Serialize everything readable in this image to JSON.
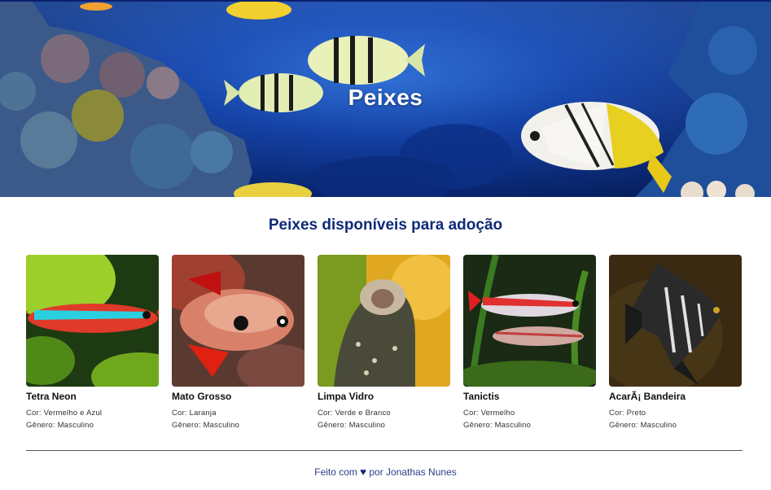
{
  "hero": {
    "title": "Peixes"
  },
  "section": {
    "title": "Peixes disponíveis para adoção"
  },
  "fish": [
    {
      "name": "Tetra Neon",
      "color": "Cor: Vermelho e Azul",
      "gender": "Gênero: Masculino"
    },
    {
      "name": "Mato Grosso",
      "color": "Cor: Laranja",
      "gender": "Gênero: Masculino"
    },
    {
      "name": "Limpa Vidro",
      "color": "Cor: Verde e Branco",
      "gender": "Gênero: Masculino"
    },
    {
      "name": "Tanictis",
      "color": "Cor: Vermelho",
      "gender": "Gênero: Masculino"
    },
    {
      "name": "AcarÃ¡ Bandeira",
      "color": "Cor: Preto",
      "gender": "Gênero: Masculino"
    }
  ],
  "footer": {
    "prefix": "Feito com",
    "heart": "♥",
    "suffix": "por Jonathas Nunes"
  },
  "colors": {
    "accent": "#0f2a78",
    "hero_bg": "#0f3fb0"
  }
}
